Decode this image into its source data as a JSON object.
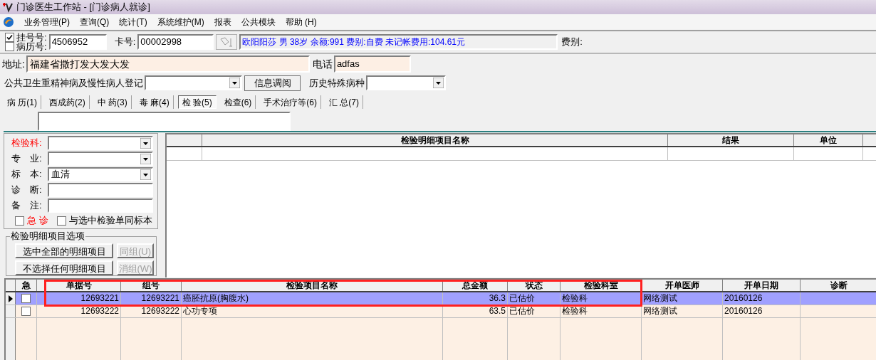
{
  "window": {
    "title": "门诊医生工作站 - [门诊病人就诊]"
  },
  "menu": [
    "业务管理(P)",
    "查询(Q)",
    "统计(T)",
    "系统维护(M)",
    "报表",
    "公共模块",
    "帮助 (H)"
  ],
  "patient": {
    "id_options": [
      {
        "label": "挂号号:",
        "checked": true
      },
      {
        "label": "病历号:",
        "checked": false
      }
    ],
    "id_value": "4506952",
    "card_label": "卡号:",
    "card_value": "00002998",
    "info": "欧阳阳莎 男 38岁 余额:991 费别:自费 未记帐费用:104.61元",
    "fee_label": "费别:"
  },
  "address": {
    "label": "地址:",
    "value": "福建省撒打发大发大发",
    "phone_label": "电话",
    "phone_value": "adfas"
  },
  "registry": {
    "label": "公共卫生重精神病及慢性病人登记",
    "button": "信息调阅",
    "history_label": "历史特殊病种"
  },
  "tabs": [
    {
      "label": "病 历(1)",
      "selected": false
    },
    {
      "label": "西成药(2)",
      "selected": false
    },
    {
      "label": "中 药(3)",
      "selected": false
    },
    {
      "label": "毒 麻(4)",
      "selected": false
    },
    {
      "label": "检 验(5)",
      "selected": true
    },
    {
      "label": "检查(6)",
      "selected": false
    },
    {
      "label": "手术治疗等(6)",
      "selected": false
    },
    {
      "label": "汇 总(7)",
      "selected": false
    }
  ],
  "form": {
    "fields": [
      {
        "label": "检验科:",
        "kind": "select",
        "required": true
      },
      {
        "label": "专　业:",
        "kind": "select",
        "required": false
      },
      {
        "label": "标　本:",
        "kind": "select",
        "value": "血清",
        "required": false
      },
      {
        "label": "诊　断:",
        "kind": "text",
        "required": false
      },
      {
        "label": "备　注:",
        "kind": "text",
        "required": false
      }
    ],
    "checkboxes": [
      {
        "label": "急 诊",
        "checked": false,
        "highlighted": true
      },
      {
        "label": "与选中检验单同标本",
        "checked": false,
        "highlighted": false
      }
    ],
    "group": {
      "title": "检验明细项目选项",
      "buttons": [
        {
          "label": "选中全部的明细项目",
          "disabled": false
        },
        {
          "label": "同组(U)",
          "disabled": true
        },
        {
          "label": "不选择任何明细项目",
          "disabled": false
        },
        {
          "label": "消组(W)",
          "disabled": true
        }
      ]
    }
  },
  "detail_table": {
    "columns": [
      "检验明细项目名称",
      "结果",
      "单位"
    ]
  },
  "orders_table": {
    "urgent_column": "急",
    "columns": [
      "单据号",
      "组号",
      "检验项目名称",
      "总金额",
      "状态",
      "检验科室",
      "开单医师",
      "开单日期",
      "诊断"
    ],
    "rows": [
      {
        "selected": true,
        "urgent": false,
        "cells": [
          "12693221",
          "12693221",
          "癌胚抗原(胸腹水)",
          "36.3",
          "已估价",
          "检验科",
          "网络测试",
          "20160126"
        ]
      },
      {
        "selected": false,
        "urgent": false,
        "cells": [
          "12693222",
          "12693222",
          "心功专项",
          "63.5",
          "已估价",
          "检验科",
          "网络测试",
          "20160126"
        ]
      }
    ]
  }
}
